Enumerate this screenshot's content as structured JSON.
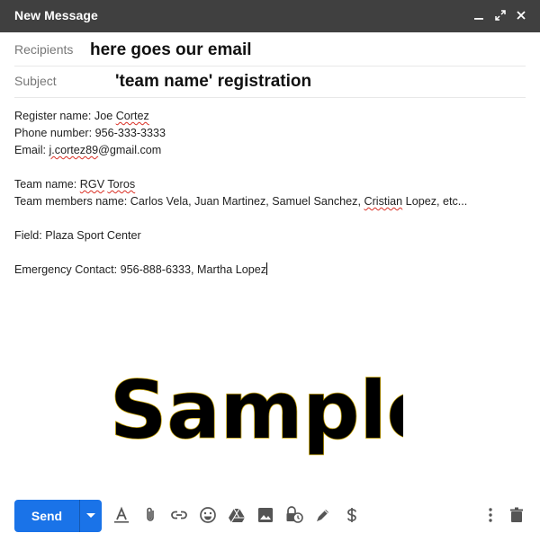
{
  "window": {
    "title": "New Message",
    "controls": [
      "minimize-icon",
      "expand-icon",
      "close-icon"
    ]
  },
  "recipients": {
    "label": "Recipients",
    "value": "here goes our email"
  },
  "subject": {
    "label": "Subject",
    "value": "'team name' registration"
  },
  "body": {
    "register_prefix": "Register name: Joe ",
    "register_last": "Cortez",
    "phone": "Phone number: 956-333-3333",
    "email_prefix": "Email: ",
    "email_user": "j.cortez89",
    "email_domain": "@gmail.com",
    "team_prefix": "Team name: ",
    "team_rgv": "RGV",
    "team_toros": "Toros",
    "members_prefix": "Team members name: Carlos Vela, Juan Martinez, Samuel Sanchez, ",
    "members_cristian": "Cristian",
    "members_suffix": " Lopez, etc...",
    "field": "Field: Plaza Sport Center",
    "emergency": "Emergency Contact: 956-888-6333, Martha Lopez"
  },
  "watermark": "Sample",
  "toolbar": {
    "send_label": "Send",
    "send_color": "#1a73e8",
    "icons": [
      "format-text-icon",
      "attach-icon",
      "link-icon",
      "emoji-icon",
      "drive-icon",
      "photo-icon",
      "confidential-icon",
      "signature-icon",
      "dollar-icon",
      "more-options-icon",
      "trash-icon"
    ]
  }
}
